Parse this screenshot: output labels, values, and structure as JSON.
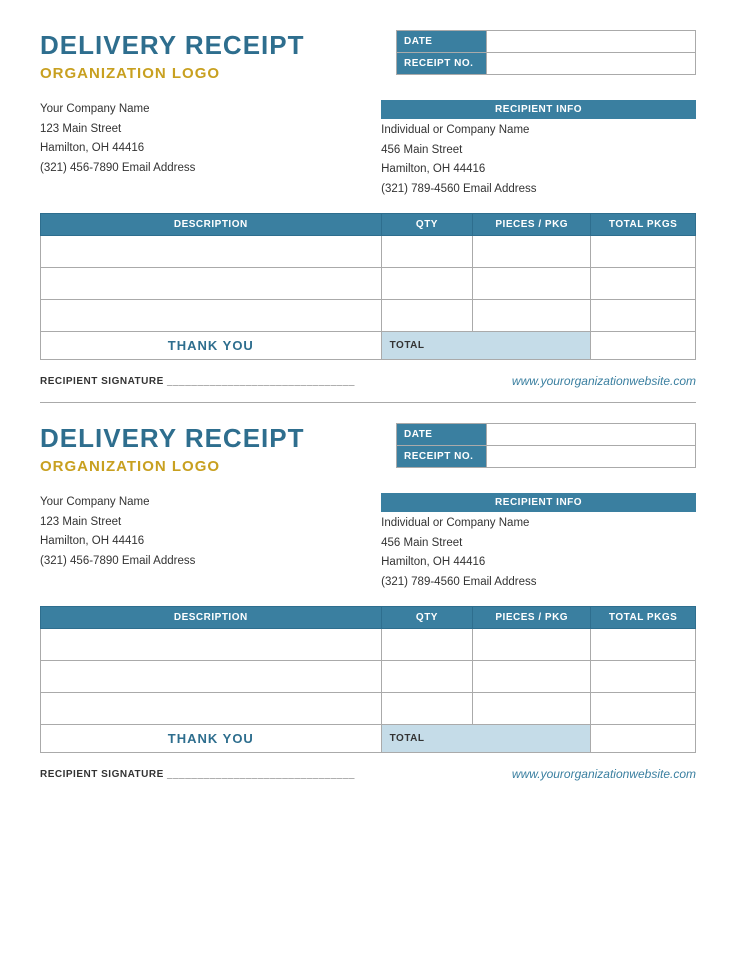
{
  "receipt1": {
    "title": "DELIVERY RECEIPT",
    "logo": "ORGANIZATION LOGO",
    "date_label": "DATE",
    "receipt_no_label": "RECEIPT NO.",
    "recipient_info_label": "RECIPIENT INFO",
    "sender": {
      "company": "Your Company Name",
      "street": "123 Main Street",
      "city": "Hamilton, OH  44416",
      "phone_email": "(321) 456-7890     Email Address"
    },
    "recipient": {
      "company": "Individual or Company Name",
      "street": "456 Main Street",
      "city": "Hamilton, OH  44416",
      "phone_email": "(321) 789-4560     Email Address"
    },
    "table": {
      "col_description": "DESCRIPTION",
      "col_qty": "QTY",
      "col_pkg": "PIECES / PKG",
      "col_total": "TOTAL PKGS",
      "rows": [
        {},
        {},
        {}
      ],
      "thank_you": "THANK YOU",
      "total_label": "TOTAL"
    },
    "signature_label": "RECIPIENT SIGNATURE _______________________________",
    "website": "www.yourorganizationwebsite.com"
  },
  "receipt2": {
    "title": "DELIVERY RECEIPT",
    "logo": "ORGANIZATION LOGO",
    "date_label": "DATE",
    "receipt_no_label": "RECEIPT NO.",
    "recipient_info_label": "RECIPIENT INFO",
    "sender": {
      "company": "Your Company Name",
      "street": "123 Main Street",
      "city": "Hamilton, OH  44416",
      "phone_email": "(321) 456-7890     Email Address"
    },
    "recipient": {
      "company": "Individual or Company Name",
      "street": "456 Main Street",
      "city": "Hamilton, OH  44416",
      "phone_email": "(321) 789-4560     Email Address"
    },
    "table": {
      "col_description": "DESCRIPTION",
      "col_qty": "QTY",
      "col_pkg": "PIECES / PKG",
      "col_total": "TOTAL PKGS",
      "rows": [
        {},
        {},
        {}
      ],
      "thank_you": "THANK YOU",
      "total_label": "TOTAL"
    },
    "signature_label": "RECIPIENT SIGNATURE _______________________________",
    "website": "www.yourorganizationwebsite.com"
  }
}
